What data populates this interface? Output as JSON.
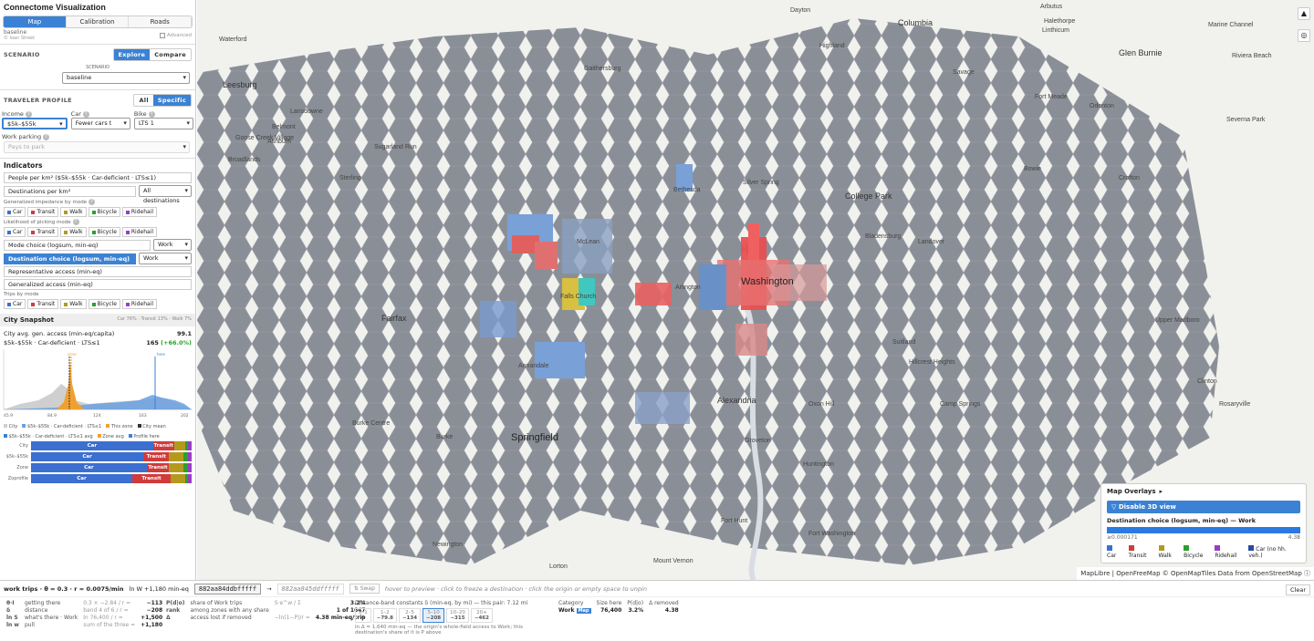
{
  "app": {
    "title": "Connectome Visualization"
  },
  "tabs": [
    "Map",
    "Calibration",
    "Roads"
  ],
  "meta": {
    "scenario_name": "baseline",
    "sub": "© loan Street",
    "advanced": "Advanced"
  },
  "scenario": {
    "label": "SCENARIO",
    "explore": "Explore",
    "compare": "Compare",
    "sublabel": "SCENARIO",
    "value": "baseline"
  },
  "traveler": {
    "label": "TRAVELER PROFILE",
    "all": "All",
    "specific": "Specific",
    "income_label": "Income",
    "income_value": "$5k–$55k",
    "car_label": "Car",
    "car_value": "Fewer cars t",
    "bike_label": "Bike",
    "bike_value": "LTS 1",
    "parking_label": "Work parking",
    "parking_value": "Pays to park"
  },
  "indicators": {
    "label": "Indicators",
    "people": "People per km² ($5k–$55k · Car-deficient · LTS≤1)",
    "destinations": "Destinations per km²",
    "destinations_filter": "All destinations",
    "gen_imp": "Generalized impedance by mode",
    "likelihood": "Likelihood of picking mode",
    "mode_choice": "Mode choice (logsum, min-eq)",
    "mode_choice_filter": "Work",
    "dest_choice": "Destination choice (logsum, min-eq)",
    "dest_choice_filter": "Work",
    "rep_access": "Representative access (min-eq)",
    "gen_access": "Generalized access (min-eq)",
    "trips_by_mode": "Trips by mode",
    "modes": [
      {
        "name": "Car",
        "color": "#3b6fd0"
      },
      {
        "name": "Transit",
        "color": "#d03b3b"
      },
      {
        "name": "Walk",
        "color": "#b39a1e"
      },
      {
        "name": "Bicycle",
        "color": "#2ca02c"
      },
      {
        "name": "Ridehail",
        "color": "#9b3bc8"
      }
    ]
  },
  "snapshot": {
    "label": "City Snapshot",
    "split": "Car 76% · Transit 13% · Walk 7%",
    "avg_label": "City avg. gen. access (min-eq/capita)",
    "avg_value": "99.1",
    "profile_label": "$5k–$55k · Car-deficient · LTS≤1",
    "profile_value": "165",
    "profile_delta": "(+66.0%)",
    "chart_ticks": [
      "45.9",
      "84.9",
      "124",
      "163",
      "202"
    ],
    "here_label": "here",
    "zone_label": "zone",
    "legend": [
      "City",
      "$5k–$55k · Car-deficient · LTS≤1",
      "This zone",
      "City mean",
      "$5k–$55k · Car-deficient · LTS≤1 avg",
      "Zone avg",
      "Profile here"
    ]
  },
  "chart_data": {
    "type": "area",
    "x_ticks": [
      "45.9",
      "84.9",
      "124",
      "163",
      "202"
    ],
    "series": [
      {
        "name": "City"
      },
      {
        "name": "$5k–$55k · Car-deficient · LTS≤1"
      },
      {
        "name": "This zone"
      }
    ]
  },
  "bars": [
    {
      "label": "City",
      "segs": [
        {
          "name": "Car",
          "pct": 76,
          "color": "#3b6fd0"
        },
        {
          "name": "Transit",
          "pct": 13,
          "color": "#d03b3b"
        },
        {
          "name": "",
          "pct": 7,
          "color": "#b39a1e"
        },
        {
          "name": "",
          "pct": 2,
          "color": "#2ca02c"
        },
        {
          "name": "",
          "pct": 2,
          "color": "#9b3bc8"
        }
      ]
    },
    {
      "label": "$5k–$55k",
      "segs": [
        {
          "name": "Car",
          "pct": 70,
          "color": "#3b6fd0"
        },
        {
          "name": "Transit",
          "pct": 16,
          "color": "#d03b3b"
        },
        {
          "name": "",
          "pct": 9,
          "color": "#b39a1e"
        },
        {
          "name": "",
          "pct": 3,
          "color": "#2ca02c"
        },
        {
          "name": "",
          "pct": 2,
          "color": "#9b3bc8"
        }
      ]
    },
    {
      "label": "Zone",
      "segs": [
        {
          "name": "Car",
          "pct": 72,
          "color": "#3b6fd0"
        },
        {
          "name": "Transit",
          "pct": 14,
          "color": "#d03b3b"
        },
        {
          "name": "",
          "pct": 9,
          "color": "#b39a1e"
        },
        {
          "name": "",
          "pct": 3,
          "color": "#2ca02c"
        },
        {
          "name": "",
          "pct": 2,
          "color": "#9b3bc8"
        }
      ]
    },
    {
      "label": "Zoprofile",
      "segs": [
        {
          "name": "Car",
          "pct": 63,
          "color": "#3b6fd0"
        },
        {
          "name": "Transit",
          "pct": 24,
          "color": "#d03b3b"
        },
        {
          "name": "",
          "pct": 9,
          "color": "#b39a1e"
        },
        {
          "name": "",
          "pct": 2,
          "color": "#2ca02c"
        },
        {
          "name": "",
          "pct": 2,
          "color": "#9b3bc8"
        }
      ]
    }
  ],
  "map": {
    "labels": [
      {
        "t": "Waterford",
        "c": ""
      },
      {
        "t": "Leesburg",
        "c": "big"
      },
      {
        "t": "Lansdowne",
        "c": ""
      },
      {
        "t": "Belmont",
        "c": ""
      },
      {
        "t": "Ashburn",
        "c": ""
      },
      {
        "t": "Goose Creek Village",
        "c": ""
      },
      {
        "t": "Broadlands",
        "c": ""
      },
      {
        "t": "Sugarland Run",
        "c": ""
      },
      {
        "t": "Sterling",
        "c": ""
      },
      {
        "t": "Gaithersburg",
        "c": ""
      },
      {
        "t": "Dayton",
        "c": ""
      },
      {
        "t": "Columbia",
        "c": "big"
      },
      {
        "t": "Arbutus",
        "c": ""
      },
      {
        "t": "Halethorpe",
        "c": ""
      },
      {
        "t": "Linthicum",
        "c": ""
      },
      {
        "t": "Marine Channel",
        "c": ""
      },
      {
        "t": "Glen Burnie",
        "c": "big"
      },
      {
        "t": "Riviera Beach",
        "c": ""
      },
      {
        "t": "Highland",
        "c": ""
      },
      {
        "t": "Savage",
        "c": ""
      },
      {
        "t": "Fort Meade",
        "c": ""
      },
      {
        "t": "Odenton",
        "c": ""
      },
      {
        "t": "Severna Park",
        "c": ""
      },
      {
        "t": "Bethesda",
        "c": ""
      },
      {
        "t": "Silver Spring",
        "c": ""
      },
      {
        "t": "College Park",
        "c": "big"
      },
      {
        "t": "Bowie",
        "c": ""
      },
      {
        "t": "Crofton",
        "c": ""
      },
      {
        "t": "Bladensburg",
        "c": ""
      },
      {
        "t": "Landover",
        "c": ""
      },
      {
        "t": "McLean",
        "c": ""
      },
      {
        "t": "Arlington",
        "c": ""
      },
      {
        "t": "Washington",
        "c": "huge"
      },
      {
        "t": "Falls Church",
        "c": ""
      },
      {
        "t": "Fairfax",
        "c": "big"
      },
      {
        "t": "Annandale",
        "c": ""
      },
      {
        "t": "Alexandria",
        "c": "big"
      },
      {
        "t": "Springfield",
        "c": "huge"
      },
      {
        "t": "Suitland",
        "c": ""
      },
      {
        "t": "Hillcrest Heights",
        "c": ""
      },
      {
        "t": "Camp Springs",
        "c": ""
      },
      {
        "t": "Oxon Hill",
        "c": ""
      },
      {
        "t": "Burke Centre",
        "c": ""
      },
      {
        "t": "Burke",
        "c": ""
      },
      {
        "t": "Fort Hunt",
        "c": ""
      },
      {
        "t": "Fort Washington",
        "c": ""
      },
      {
        "t": "Mount Vernon",
        "c": ""
      },
      {
        "t": "Lorton",
        "c": ""
      },
      {
        "t": "Newington",
        "c": ""
      },
      {
        "t": "Groveton",
        "c": ""
      },
      {
        "t": "Huntington",
        "c": ""
      },
      {
        "t": "Clinton",
        "c": ""
      },
      {
        "t": "Rosaryville",
        "c": ""
      },
      {
        "t": "Upper Marlboro",
        "c": ""
      }
    ]
  },
  "overlay": {
    "title": "Map Overlays",
    "toggle": "▸",
    "disable3d": "Disable 3D view",
    "metric": "Destination choice (logsum, min-eq) — Work",
    "min": "≥0.000171",
    "max": "4.38",
    "legend": [
      {
        "name": "Car",
        "color": "#3b6fd0"
      },
      {
        "name": "Transit",
        "color": "#d03b3b"
      },
      {
        "name": "Walk",
        "color": "#b39a1e"
      },
      {
        "name": "Bicycle",
        "color": "#2ca02c"
      },
      {
        "name": "Ridehail",
        "color": "#9b3bc8"
      },
      {
        "name": "Car (no hh. veh.)",
        "color": "#2a4aa0"
      }
    ]
  },
  "attribution": "MapLibre | OpenFreeMap © OpenMapTiles Data from OpenStreetMap",
  "bottom": {
    "trip_info": "work trips · θ = 0.3 · r = 0.0075/min",
    "lnw": "ln W +1,180 min-eq",
    "origin": "882aa84ddbfffff",
    "arrow": "→",
    "dest": "882aa845ddfffff",
    "swap": "⇅ Swap",
    "hint": "hover to preview · click to freeze a destination · click the origin or empty space to unpin",
    "clear": "Clear",
    "left_rows": [
      {
        "sym": "θ·I",
        "desc": "getting there",
        "expr": "0.3 × −2.84 / r =",
        "val": "−113"
      },
      {
        "sym": "δ",
        "desc": "distance",
        "expr": "band 4 of 6 / r =",
        "val": "−208"
      },
      {
        "sym": "ln S",
        "desc": "what's there · Work",
        "expr": "ln 76,400 / r =",
        "val": "+1,500"
      },
      {
        "sym": "ln w",
        "desc": "pull",
        "expr": "sum of the three =",
        "val": "+1,180"
      }
    ],
    "mid_rows": [
      {
        "sym": "P(d|o)",
        "desc": "share of Work trips",
        "expr": "S·e^w / Σ",
        "val": "3.2%"
      },
      {
        "sym": "rank",
        "desc": "among zones with any share",
        "expr": "",
        "val": "1 of 1647"
      },
      {
        "sym": "Δ",
        "desc": "access lost if removed",
        "expr": "−ln(1−P)/r =",
        "val": "4.38 min-eq/trip"
      }
    ],
    "band_title": "Distance-band constants δ (min-eq, by mi) — this pair: 7.12 mi",
    "bands": [
      {
        "r": "0–1",
        "v": "0"
      },
      {
        "r": "1–2",
        "v": "−79.8"
      },
      {
        "r": "2–5",
        "v": "−134"
      },
      {
        "r": "5–10",
        "v": "−208"
      },
      {
        "r": "10–20",
        "v": "−315"
      },
      {
        "r": "20+",
        "v": "−462"
      }
    ],
    "band_note": "In Δ = 1,640 min-eq — the origin's whole-field access to Work; this destination's share of it is P above",
    "cat_headers": [
      "Category",
      "Size here",
      "P(d|o)",
      "Δ removed"
    ],
    "cat_row": {
      "name": "Work",
      "tag": "Map",
      "size": "76,400",
      "p": "3.2%",
      "d": "4.38"
    }
  }
}
